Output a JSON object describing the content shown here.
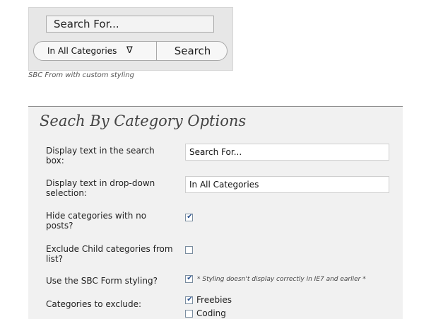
{
  "preview": {
    "search_text": "Search For...",
    "category_select": "In All Categories",
    "dropdown_arrow": "∇",
    "search_button": "Search",
    "caption": "SBC From with custom styling"
  },
  "options": {
    "title": "Seach By Category Options",
    "display_text_label": "Display text in the search box:",
    "display_text_value": "Search For...",
    "dropdown_text_label": "Display text in drop-down selection:",
    "dropdown_text_value": "In All Categories",
    "hide_empty_label": "Hide categories with no posts?",
    "hide_empty_checked": true,
    "exclude_child_label": "Exclude Child categories from list?",
    "exclude_child_checked": false,
    "styling_label": "Use the SBC Form styling?",
    "styling_checked": true,
    "styling_note": "* Styling doesn't display correctly in IE7 and earlier *",
    "exclude_label": "Categories to exclude:",
    "categories": [
      {
        "name": "Freebies",
        "checked": true
      },
      {
        "name": "Coding",
        "checked": false
      }
    ]
  },
  "colors": {
    "panel_bg": "#f1f1f1",
    "preview_bg": "#e7e7e7",
    "check_color": "#28508e"
  }
}
